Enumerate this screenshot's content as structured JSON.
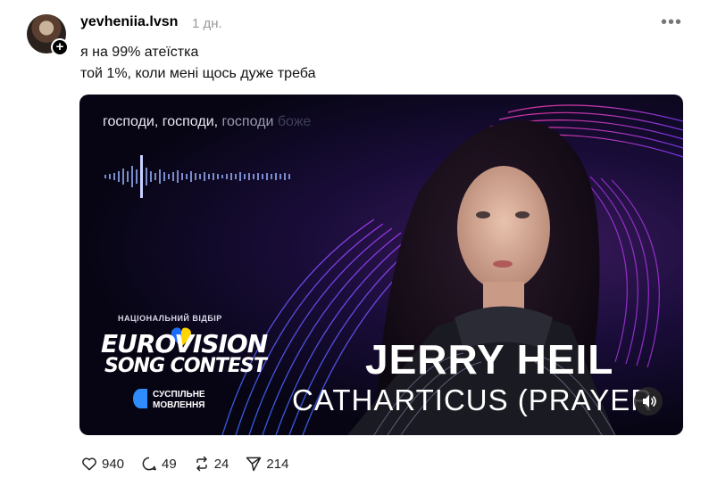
{
  "post": {
    "username": "yevheniia.lvsn",
    "time": "1 дн.",
    "more_label": "•••",
    "caption_line1": "я на 99% атеїстка",
    "caption_line2": "той 1%, коли мені щось дуже треба"
  },
  "media": {
    "lyric_main": "господи, господи, ",
    "lyric_fade1": "господи ",
    "lyric_fade2": "боже",
    "national": "НАЦІОНАЛЬНИЙ ВІДБІР",
    "eurovision_line1": "EUROVISION",
    "eurovision_line2": "SONG CONTEST",
    "broadcaster_line1": "СУСПІЛЬНЕ",
    "broadcaster_line2": "МОВЛЕННЯ",
    "artist": "JERRY HEIL",
    "song": "CATHARTICUS (PRAYER",
    "sound_icon": "speaker-icon"
  },
  "actions": {
    "likes": "940",
    "comments": "49",
    "reposts": "24",
    "shares": "214"
  },
  "colors": {
    "background": "#ffffff",
    "muted": "#999999",
    "media_bg": "#0b0820",
    "accent_pink": "#ff3da8",
    "accent_blue": "#3a6bff"
  }
}
